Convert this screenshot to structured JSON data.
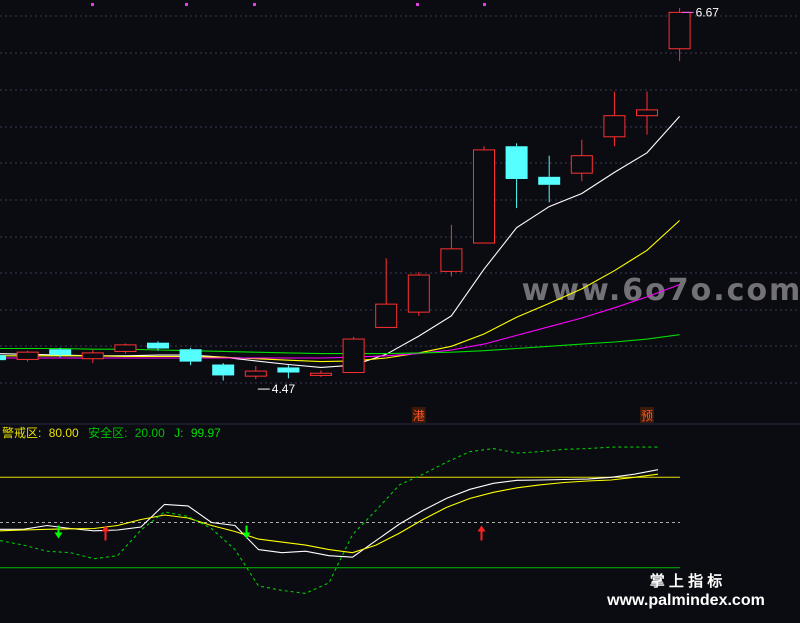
{
  "chart_data": [
    {
      "type": "candlestick",
      "panel": "price",
      "candles": [
        {
          "o": 6.12,
          "c": 6.05,
          "h": 6.15,
          "l": 6.02
        },
        {
          "o": 6.06,
          "c": 6.16,
          "h": 6.18,
          "l": 6.03
        },
        {
          "o": 6.2,
          "c": 6.12,
          "h": 6.22,
          "l": 6.09
        },
        {
          "o": 6.07,
          "c": 6.15,
          "h": 6.19,
          "l": 6.01
        },
        {
          "o": 6.17,
          "c": 6.26,
          "h": 6.28,
          "l": 6.14
        },
        {
          "o": 6.29,
          "c": 6.21,
          "h": 6.31,
          "l": 6.18
        },
        {
          "o": 6.2,
          "c": 6.03,
          "h": 6.22,
          "l": 5.98
        },
        {
          "o": 5.99,
          "c": 5.84,
          "h": 6.01,
          "l": 5.77
        },
        {
          "o": 5.83,
          "c": 5.9,
          "h": 5.97,
          "l": 5.79
        },
        {
          "o": 5.95,
          "c": 5.88,
          "h": 5.98,
          "l": 5.8
        },
        {
          "o": 5.84,
          "c": 5.87,
          "h": 5.91,
          "l": 5.82
        },
        {
          "o": 5.88,
          "c": 6.34,
          "h": 6.37,
          "l": 5.88
        },
        {
          "o": 6.5,
          "c": 6.82,
          "h": 7.45,
          "l": 6.49
        },
        {
          "o": 6.71,
          "c": 7.22,
          "h": 7.26,
          "l": 6.66
        },
        {
          "o": 7.27,
          "c": 7.58,
          "h": 7.91,
          "l": 7.2
        },
        {
          "o": 7.66,
          "c": 8.94,
          "h": 8.99,
          "l": 7.66
        },
        {
          "o": 8.99,
          "c": 8.54,
          "h": 9.03,
          "l": 8.14
        },
        {
          "o": 8.57,
          "c": 8.46,
          "h": 8.86,
          "l": 8.22
        },
        {
          "o": 8.62,
          "c": 8.86,
          "h": 9.08,
          "l": 8.51
        },
        {
          "o": 9.12,
          "c": 9.41,
          "h": 9.74,
          "l": 8.99
        },
        {
          "o": 9.41,
          "c": 9.49,
          "h": 9.74,
          "l": 9.15
        },
        {
          "o": 10.33,
          "c": 10.83,
          "h": 10.89,
          "l": 10.16
        }
      ],
      "ma_lines": [
        {
          "color": "#ffffff",
          "values": [
            6.14,
            6.13,
            6.12,
            6.11,
            6.11,
            6.12,
            6.12,
            6.09,
            6.04,
            5.99,
            5.95,
            5.98,
            6.13,
            6.38,
            6.66,
            7.3,
            7.87,
            8.16,
            8.34,
            8.63,
            8.9,
            9.4
          ]
        },
        {
          "color": "#ffff00",
          "values": [
            6.11,
            6.11,
            6.11,
            6.11,
            6.1,
            6.1,
            6.1,
            6.09,
            6.07,
            6.05,
            6.03,
            6.04,
            6.08,
            6.15,
            6.24,
            6.41,
            6.64,
            6.83,
            7.03,
            7.28,
            7.56,
            7.97
          ]
        },
        {
          "color": "#ff00ff",
          "values": [
            6.08,
            6.08,
            6.08,
            6.08,
            6.08,
            6.08,
            6.08,
            6.08,
            6.08,
            6.08,
            6.08,
            6.09,
            6.11,
            6.14,
            6.19,
            6.27,
            6.39,
            6.51,
            6.63,
            6.77,
            6.92,
            7.09
          ]
        },
        {
          "color": "#00dd00",
          "values": [
            6.21,
            6.21,
            6.21,
            6.2,
            6.2,
            6.19,
            6.18,
            6.17,
            6.16,
            6.15,
            6.14,
            6.14,
            6.14,
            6.15,
            6.16,
            6.18,
            6.21,
            6.24,
            6.27,
            6.3,
            6.34,
            6.4
          ]
        }
      ],
      "annotations": [
        {
          "text": "6.67",
          "x_index": 21,
          "value": 10.83,
          "color": "#ffffff",
          "pointer": "#ff66ff"
        },
        {
          "text": "4.47",
          "x_index": 8,
          "value": 5.79,
          "color": "#ffffff",
          "pointer": "#ffffff"
        }
      ],
      "tags": [
        {
          "text": "港",
          "x_index": 13,
          "color": "#ff5522",
          "bg": "#3a1a0a"
        },
        {
          "text": "预",
          "x_index": 20,
          "color": "#ff5522",
          "bg": "#3a1a0a"
        }
      ],
      "grid": true,
      "watermark": "www.6o7o.com"
    },
    {
      "type": "line",
      "panel": "indicator",
      "legend": {
        "warn_label": "警戒区:",
        "warn_value": "80.00",
        "safe_label": "安全区:",
        "safe_value": "20.00",
        "j_label": "J:",
        "j_value": "99.97"
      },
      "ylim": [
        -10,
        110
      ],
      "hlines": [
        {
          "value": 80,
          "color": "#e8e000",
          "dash": false
        },
        {
          "value": 20,
          "color": "#00bb00",
          "dash": false
        },
        {
          "value": 50,
          "color": "#aaaaaa",
          "dash": true
        }
      ],
      "series": [
        {
          "role": "K",
          "color": "#ffffff",
          "dash": false,
          "values": [
            45.5,
            45.5,
            48,
            46,
            44.5,
            45,
            47,
            62,
            61,
            50,
            48,
            32,
            30,
            31,
            28,
            27,
            38,
            49,
            58,
            66,
            72,
            76,
            78,
            78.2,
            78.5,
            78.8,
            80,
            82,
            85
          ]
        },
        {
          "role": "D",
          "color": "#ffff00",
          "dash": false,
          "values": [
            44.5,
            45,
            45.5,
            45.8,
            46,
            48,
            52,
            55,
            53,
            48,
            44,
            39,
            37,
            35,
            32,
            30,
            35,
            43,
            52,
            60,
            66,
            70,
            73,
            75,
            76.5,
            77.5,
            78.2,
            80,
            82
          ]
        },
        {
          "role": "J",
          "color": "#00cc00",
          "dash": true,
          "values": [
            38,
            35,
            31,
            30,
            26,
            28,
            45,
            57,
            54,
            46,
            32,
            8,
            5,
            3,
            10,
            42,
            58,
            75,
            82,
            90,
            97,
            99,
            96,
            97,
            98.5,
            99,
            100,
            99.97,
            99.97
          ]
        }
      ],
      "signals": [
        {
          "x_index": 3,
          "dir": "down",
          "color": "#00ff00"
        },
        {
          "x_index": 5,
          "dir": "up",
          "color": "#ff2020"
        },
        {
          "x_index": 11,
          "dir": "down",
          "color": "#00ff00"
        },
        {
          "x_index": 21,
          "dir": "up",
          "color": "#ff2020"
        }
      ],
      "watermark": {
        "line1": "掌 上 指 标",
        "line2": "www.palmindex.com"
      }
    }
  ],
  "colors": {
    "up": "#ff3030",
    "down": "#55ffff",
    "grid": "#3b3b55",
    "bg": "#0b0b12",
    "warn": "#e8e000",
    "safe": "#00c000"
  }
}
